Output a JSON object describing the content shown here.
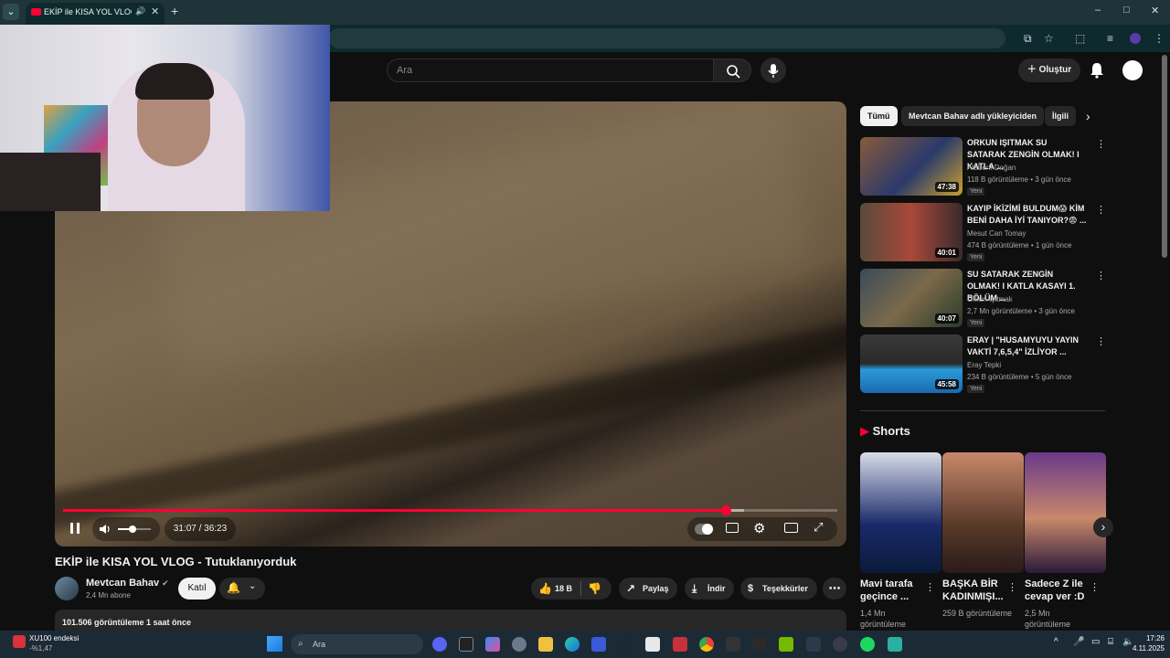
{
  "browser": {
    "tab_title": "EKİP ile KISA YOL VLOG - Tu",
    "new_tab": "+",
    "win_min": "–",
    "win_max": "□",
    "win_close": "✕"
  },
  "youtube_header": {
    "search_placeholder": "Ara",
    "create_label": "Oluştur"
  },
  "player": {
    "time_display": "31:07 / 36:23",
    "progress_played_pct": 85.6,
    "progress_buffered_pct": 88.0
  },
  "video": {
    "title": "EKİP ile KISA YOL VLOG - Tutuklanıyorduk",
    "channel_name": "Mevtcan Bahav",
    "channel_subs": "2,4 Mn abone",
    "join_label": "Katıl",
    "like_count": "18 B",
    "share_label": "Paylaş",
    "download_label": "İndir",
    "thanks_label": "Teşekkürler",
    "stats": "101.506 görüntüleme  1 saat önce"
  },
  "sidebar": {
    "chips": [
      "Tümü",
      "Mevtcan Bahav adlı yükleyiciden",
      "İlgili"
    ],
    "recs": [
      {
        "title": "ORKUN IŞITMAK SU SATARAK ZENGİN OLMAK! I KATLA ...",
        "channel": "Ataberk Doğan",
        "meta": "118 B görüntüleme • 3 gün önce",
        "badge": "Yeni",
        "duration": "47:38"
      },
      {
        "title": "KAYIP İKİZİMİ BULDUM😱 KİM BENİ DAHA İYİ TANIYOR?😨 ...",
        "channel": "Mesut Can Tomay",
        "meta": "474 B görüntüleme • 1 gün önce",
        "badge": "Yeni",
        "duration": "40:01"
      },
      {
        "title": "SU SATARAK ZENGİN OLMAK! I KATLA KASAYI 1. BÖLÜM ...",
        "channel": "Orkun Işıtmak",
        "meta": "2,7 Mn görüntüleme • 3 gün önce",
        "badge": "Yeni",
        "duration": "40:07"
      },
      {
        "title": "ERAY | \"HUSAMYUYU YAYIN VAKTİ 7,6,5,4\" İZLİYOR ...",
        "channel": "Eray Tepki",
        "meta": "234 B görüntüleme • 5 gün önce",
        "badge": "Yeni",
        "duration": "45:58"
      }
    ],
    "shorts_heading": "Shorts",
    "shorts": [
      {
        "title": "Mavi tarafa geçince ...",
        "views": "1,4 Mn görüntüleme"
      },
      {
        "title": "BAŞKA BİR KADINMIŞI...",
        "views": "259 B görüntüleme"
      },
      {
        "title": "Sadece Z ile cevap ver :D",
        "views": "2,5 Mn görüntüleme"
      }
    ]
  },
  "taskbar": {
    "stock_name": "XU100 endeksi",
    "stock_change": "-%1,47",
    "search_label": "Ara",
    "time": "17:26",
    "date": "4.11.2025"
  },
  "colors": {
    "accent_red": "#ff0033",
    "bg": "#0f0f0f",
    "chip_bg": "#272727"
  }
}
